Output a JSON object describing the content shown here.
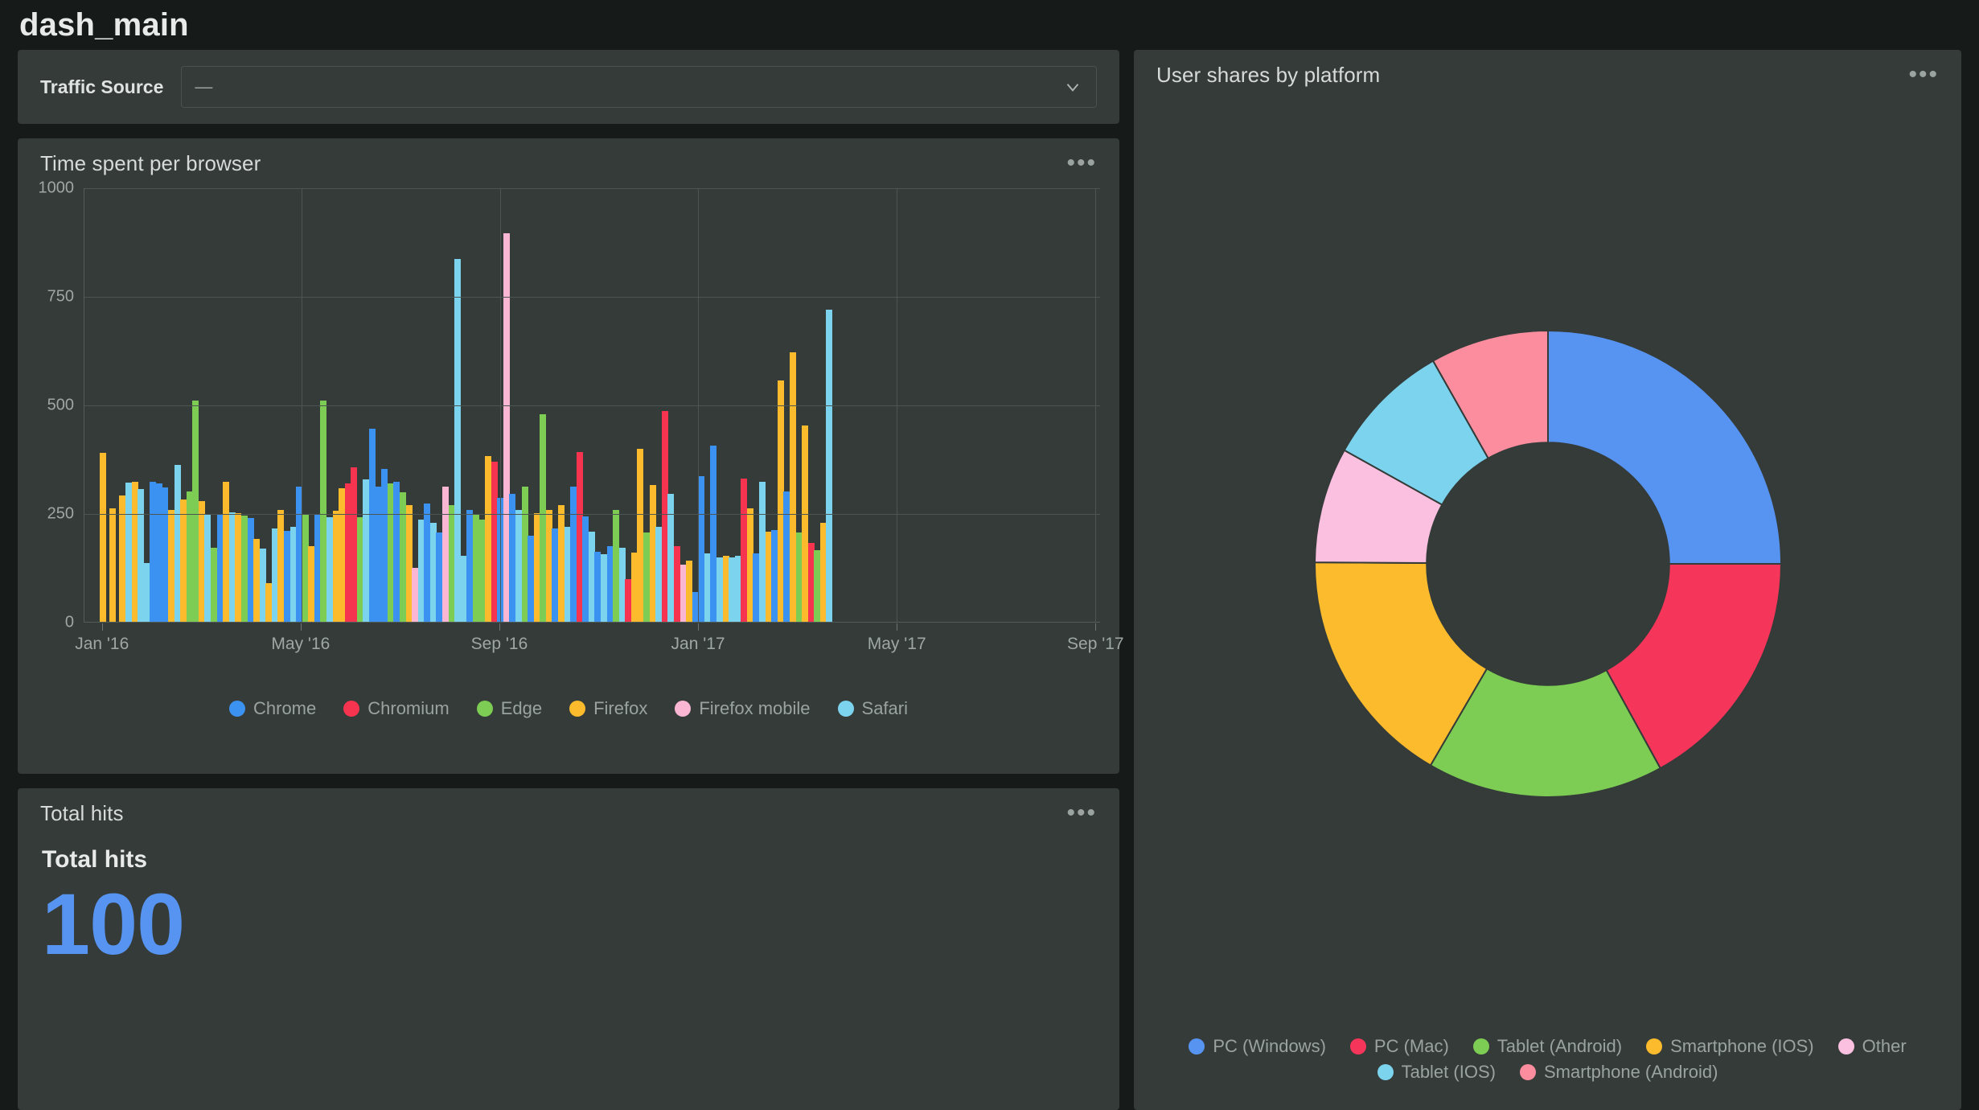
{
  "dashboard": {
    "title": "dash_main"
  },
  "variables": {
    "traffic_source": {
      "label": "Traffic Source",
      "value": "—",
      "placeholder": "—",
      "chevron_icon": "chevron-down-icon"
    }
  },
  "panels": {
    "time_spent": {
      "title": "Time spent per browser",
      "menu_icon": "panel-menu-icon",
      "menu_glyph": "•••"
    },
    "total_hits": {
      "title": "Total hits",
      "menu_glyph": "•••",
      "stat_name": "Total hits",
      "stat_value": "100",
      "stat_color": "#5794f2"
    },
    "user_shares": {
      "title": "User shares by platform",
      "menu_glyph": "•••"
    }
  },
  "chart_data": [
    {
      "id": "time_spent_per_browser",
      "type": "bar",
      "title": "Time spent per browser",
      "xlabel": "",
      "ylabel": "",
      "ylim": [
        0,
        1000
      ],
      "yticks": [
        0,
        250,
        500,
        750,
        1000
      ],
      "ytick_labels": [
        "0",
        "250",
        "500",
        "750",
        "1000"
      ],
      "xtick_labels": [
        "Jan '16",
        "May '16",
        "Sep '16",
        "Jan '17",
        "May '17",
        "Sep '17"
      ],
      "xtick_positions": [
        0.018,
        0.2135,
        0.409,
        0.6045,
        0.8,
        0.9955
      ],
      "grid": true,
      "legend_position": "bottom",
      "legend": [
        {
          "name": "Chrome",
          "color": "#3c92f0"
        },
        {
          "name": "Chromium",
          "color": "#f6344f"
        },
        {
          "name": "Edge",
          "color": "#7dcc53"
        },
        {
          "name": "Firefox",
          "color": "#fcbb2c"
        },
        {
          "name": "Firefox mobile",
          "color": "#fbb6d3"
        },
        {
          "name": "Safari",
          "color": "#7cd3ee"
        }
      ],
      "bars": [
        {
          "x": 0.018,
          "value": 388,
          "series": "Firefox"
        },
        {
          "x": 0.0275,
          "value": 262,
          "series": "Firefox"
        },
        {
          "x": 0.0375,
          "value": 290,
          "series": "Firefox"
        },
        {
          "x": 0.0435,
          "value": 320,
          "series": "Safari"
        },
        {
          "x": 0.0495,
          "value": 322,
          "series": "Firefox"
        },
        {
          "x": 0.0555,
          "value": 305,
          "series": "Safari"
        },
        {
          "x": 0.0615,
          "value": 135,
          "series": "Safari"
        },
        {
          "x": 0.0675,
          "value": 322,
          "series": "Chrome"
        },
        {
          "x": 0.0735,
          "value": 318,
          "series": "Chrome"
        },
        {
          "x": 0.0795,
          "value": 310,
          "series": "Chrome"
        },
        {
          "x": 0.0855,
          "value": 258,
          "series": "Firefox"
        },
        {
          "x": 0.0915,
          "value": 362,
          "series": "Safari"
        },
        {
          "x": 0.0975,
          "value": 282,
          "series": "Firefox"
        },
        {
          "x": 0.1035,
          "value": 300,
          "series": "Edge"
        },
        {
          "x": 0.1095,
          "value": 510,
          "series": "Edge"
        },
        {
          "x": 0.1155,
          "value": 278,
          "series": "Firefox"
        },
        {
          "x": 0.1215,
          "value": 248,
          "series": "Safari"
        },
        {
          "x": 0.1275,
          "value": 170,
          "series": "Edge"
        },
        {
          "x": 0.1335,
          "value": 248,
          "series": "Chrome"
        },
        {
          "x": 0.1395,
          "value": 322,
          "series": "Firefox"
        },
        {
          "x": 0.1455,
          "value": 252,
          "series": "Safari"
        },
        {
          "x": 0.1515,
          "value": 250,
          "series": "Firefox"
        },
        {
          "x": 0.1575,
          "value": 245,
          "series": "Edge"
        },
        {
          "x": 0.1635,
          "value": 238,
          "series": "Chrome"
        },
        {
          "x": 0.1695,
          "value": 190,
          "series": "Firefox"
        },
        {
          "x": 0.1755,
          "value": 168,
          "series": "Safari"
        },
        {
          "x": 0.1815,
          "value": 88,
          "series": "Firefox"
        },
        {
          "x": 0.1875,
          "value": 215,
          "series": "Safari"
        },
        {
          "x": 0.1935,
          "value": 258,
          "series": "Firefox"
        },
        {
          "x": 0.1995,
          "value": 210,
          "series": "Chrome"
        },
        {
          "x": 0.2055,
          "value": 218,
          "series": "Safari"
        },
        {
          "x": 0.2115,
          "value": 312,
          "series": "Chrome"
        },
        {
          "x": 0.2175,
          "value": 248,
          "series": "Edge"
        },
        {
          "x": 0.2235,
          "value": 175,
          "series": "Firefox"
        },
        {
          "x": 0.2295,
          "value": 248,
          "series": "Chrome"
        },
        {
          "x": 0.2355,
          "value": 510,
          "series": "Edge"
        },
        {
          "x": 0.2415,
          "value": 240,
          "series": "Safari"
        },
        {
          "x": 0.2475,
          "value": 255,
          "series": "Firefox"
        },
        {
          "x": 0.2535,
          "value": 308,
          "series": "Firefox"
        },
        {
          "x": 0.2595,
          "value": 318,
          "series": "Chromium"
        },
        {
          "x": 0.2655,
          "value": 355,
          "series": "Chromium"
        },
        {
          "x": 0.2715,
          "value": 240,
          "series": "Edge"
        },
        {
          "x": 0.2775,
          "value": 328,
          "series": "Safari"
        },
        {
          "x": 0.2835,
          "value": 445,
          "series": "Chrome"
        },
        {
          "x": 0.2895,
          "value": 312,
          "series": "Chrome"
        },
        {
          "x": 0.2955,
          "value": 352,
          "series": "Chrome"
        },
        {
          "x": 0.3015,
          "value": 318,
          "series": "Edge"
        },
        {
          "x": 0.3075,
          "value": 322,
          "series": "Chrome"
        },
        {
          "x": 0.3135,
          "value": 298,
          "series": "Edge"
        },
        {
          "x": 0.3195,
          "value": 268,
          "series": "Firefox"
        },
        {
          "x": 0.3255,
          "value": 125,
          "series": "Firefox mobile"
        },
        {
          "x": 0.3315,
          "value": 235,
          "series": "Safari"
        },
        {
          "x": 0.3375,
          "value": 272,
          "series": "Chrome"
        },
        {
          "x": 0.3435,
          "value": 228,
          "series": "Safari"
        },
        {
          "x": 0.3495,
          "value": 205,
          "series": "Chrome"
        },
        {
          "x": 0.3555,
          "value": 312,
          "series": "Firefox mobile"
        },
        {
          "x": 0.3615,
          "value": 268,
          "series": "Edge"
        },
        {
          "x": 0.3675,
          "value": 835,
          "series": "Safari"
        },
        {
          "x": 0.3735,
          "value": 152,
          "series": "Safari"
        },
        {
          "x": 0.3795,
          "value": 258,
          "series": "Chrome"
        },
        {
          "x": 0.3855,
          "value": 246,
          "series": "Edge"
        },
        {
          "x": 0.3915,
          "value": 235,
          "series": "Edge"
        },
        {
          "x": 0.3975,
          "value": 382,
          "series": "Firefox"
        },
        {
          "x": 0.4035,
          "value": 368,
          "series": "Chromium"
        },
        {
          "x": 0.4095,
          "value": 285,
          "series": "Chrome"
        },
        {
          "x": 0.4155,
          "value": 895,
          "series": "Firefox mobile"
        },
        {
          "x": 0.4215,
          "value": 295,
          "series": "Chrome"
        },
        {
          "x": 0.4275,
          "value": 258,
          "series": "Safari"
        },
        {
          "x": 0.4335,
          "value": 312,
          "series": "Edge"
        },
        {
          "x": 0.4395,
          "value": 198,
          "series": "Chrome"
        },
        {
          "x": 0.4455,
          "value": 250,
          "series": "Firefox"
        },
        {
          "x": 0.4515,
          "value": 478,
          "series": "Edge"
        },
        {
          "x": 0.4575,
          "value": 258,
          "series": "Firefox"
        },
        {
          "x": 0.4635,
          "value": 215,
          "series": "Chrome"
        },
        {
          "x": 0.4695,
          "value": 268,
          "series": "Firefox"
        },
        {
          "x": 0.4755,
          "value": 218,
          "series": "Safari"
        },
        {
          "x": 0.4815,
          "value": 312,
          "series": "Chrome"
        },
        {
          "x": 0.4875,
          "value": 390,
          "series": "Chromium"
        },
        {
          "x": 0.4935,
          "value": 242,
          "series": "Chrome"
        },
        {
          "x": 0.4995,
          "value": 208,
          "series": "Safari"
        },
        {
          "x": 0.5055,
          "value": 162,
          "series": "Chrome"
        },
        {
          "x": 0.5115,
          "value": 155,
          "series": "Safari"
        },
        {
          "x": 0.5175,
          "value": 175,
          "series": "Chrome"
        },
        {
          "x": 0.5235,
          "value": 258,
          "series": "Edge"
        },
        {
          "x": 0.5295,
          "value": 170,
          "series": "Safari"
        },
        {
          "x": 0.5355,
          "value": 98,
          "series": "Chromium"
        },
        {
          "x": 0.5415,
          "value": 160,
          "series": "Firefox"
        },
        {
          "x": 0.5475,
          "value": 398,
          "series": "Firefox"
        },
        {
          "x": 0.5535,
          "value": 205,
          "series": "Edge"
        },
        {
          "x": 0.5595,
          "value": 315,
          "series": "Firefox"
        },
        {
          "x": 0.5655,
          "value": 218,
          "series": "Safari"
        },
        {
          "x": 0.5715,
          "value": 485,
          "series": "Chromium"
        },
        {
          "x": 0.5775,
          "value": 295,
          "series": "Safari"
        },
        {
          "x": 0.5835,
          "value": 175,
          "series": "Chromium"
        },
        {
          "x": 0.5895,
          "value": 132,
          "series": "Firefox mobile"
        },
        {
          "x": 0.5955,
          "value": 140,
          "series": "Firefox"
        },
        {
          "x": 0.6015,
          "value": 68,
          "series": "Chrome"
        },
        {
          "x": 0.6075,
          "value": 335,
          "series": "Chrome"
        },
        {
          "x": 0.6135,
          "value": 158,
          "series": "Safari"
        },
        {
          "x": 0.6195,
          "value": 405,
          "series": "Chrome"
        },
        {
          "x": 0.6255,
          "value": 148,
          "series": "Safari"
        },
        {
          "x": 0.6315,
          "value": 152,
          "series": "Firefox"
        },
        {
          "x": 0.6375,
          "value": 148,
          "series": "Safari"
        },
        {
          "x": 0.6435,
          "value": 152,
          "series": "Safari"
        },
        {
          "x": 0.6495,
          "value": 330,
          "series": "Chromium"
        },
        {
          "x": 0.6555,
          "value": 262,
          "series": "Firefox"
        },
        {
          "x": 0.6615,
          "value": 158,
          "series": "Chrome"
        },
        {
          "x": 0.6675,
          "value": 322,
          "series": "Safari"
        },
        {
          "x": 0.6735,
          "value": 208,
          "series": "Firefox"
        },
        {
          "x": 0.6795,
          "value": 212,
          "series": "Chrome"
        },
        {
          "x": 0.6855,
          "value": 555,
          "series": "Firefox"
        },
        {
          "x": 0.6915,
          "value": 300,
          "series": "Chrome"
        },
        {
          "x": 0.6975,
          "value": 620,
          "series": "Firefox"
        },
        {
          "x": 0.7035,
          "value": 205,
          "series": "Edge"
        },
        {
          "x": 0.7095,
          "value": 452,
          "series": "Firefox"
        },
        {
          "x": 0.7155,
          "value": 182,
          "series": "Chromium"
        },
        {
          "x": 0.7215,
          "value": 165,
          "series": "Edge"
        },
        {
          "x": 0.7275,
          "value": 228,
          "series": "Firefox"
        },
        {
          "x": 0.7335,
          "value": 718,
          "series": "Safari"
        }
      ]
    },
    {
      "id": "user_shares_by_platform",
      "type": "pie",
      "variant": "donut",
      "title": "User shares by platform",
      "legend_position": "bottom",
      "inner_radius_ratio": 0.52,
      "slices": [
        {
          "label": "PC (Windows)",
          "value": 25.0,
          "color": "#5794f2"
        },
        {
          "label": "PC (Mac)",
          "value": 17.0,
          "color": "#f6355a"
        },
        {
          "label": "Tablet (Android)",
          "value": 16.4,
          "color": "#7dcc53"
        },
        {
          "label": "Smartphone (IOS)",
          "value": 16.7,
          "color": "#fcbb2c"
        },
        {
          "label": "Other",
          "value": 8.0,
          "color": "#fbc0e0"
        },
        {
          "label": "Tablet (IOS)",
          "value": 8.7,
          "color": "#7cd3ee"
        },
        {
          "label": "Smartphone (Android)",
          "value": 8.2,
          "color": "#fb8d9e"
        }
      ]
    }
  ]
}
